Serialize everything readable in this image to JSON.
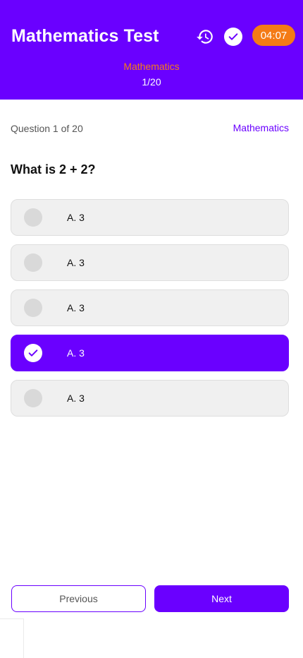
{
  "header": {
    "title": "Mathematics Test",
    "history_icon": "history-icon",
    "submit_icon": "check-circle-icon",
    "timer": "04:07",
    "subject": "Mathematics",
    "progress": "1/20"
  },
  "question": {
    "counter": "Question 1 of 20",
    "subject": "Mathematics",
    "text": "What is 2 + 2?"
  },
  "options": [
    {
      "label": "A. 3",
      "selected": false
    },
    {
      "label": "A. 3",
      "selected": false
    },
    {
      "label": "A. 3",
      "selected": false
    },
    {
      "label": "A. 3",
      "selected": true
    },
    {
      "label": "A. 3",
      "selected": false
    }
  ],
  "footer": {
    "previous_label": "Previous",
    "next_label": "Next"
  },
  "colors": {
    "primary": "#6a00ff",
    "accent": "#f47b16"
  }
}
